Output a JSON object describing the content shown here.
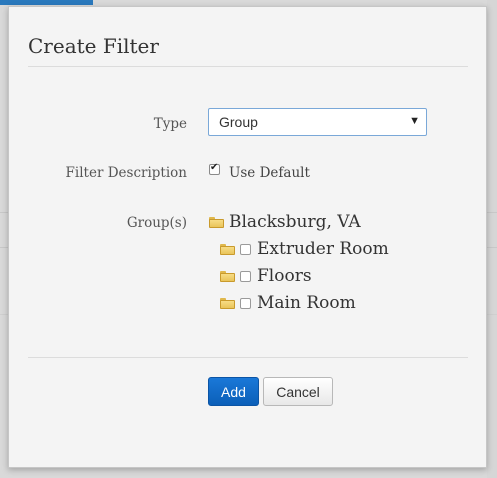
{
  "dialog": {
    "title": "Create Filter"
  },
  "form": {
    "type_label": "Type",
    "type_value": "Group",
    "description_label": "Filter Description",
    "use_default_label": "Use Default",
    "use_default_checked": true,
    "groups_label": "Group(s)",
    "groups": {
      "root": "Blacksburg, VA",
      "children": [
        "Extruder Room",
        "Floors",
        "Main Room"
      ]
    }
  },
  "buttons": {
    "add_label": "Add",
    "cancel_label": "Cancel"
  },
  "colors": {
    "primary_button": "#0b5fb8",
    "folder": "#f0cf6e",
    "select_border": "#7aa8d8"
  },
  "icons": {
    "dropdown": "chevron-down-icon",
    "folder": "folder-icon"
  }
}
